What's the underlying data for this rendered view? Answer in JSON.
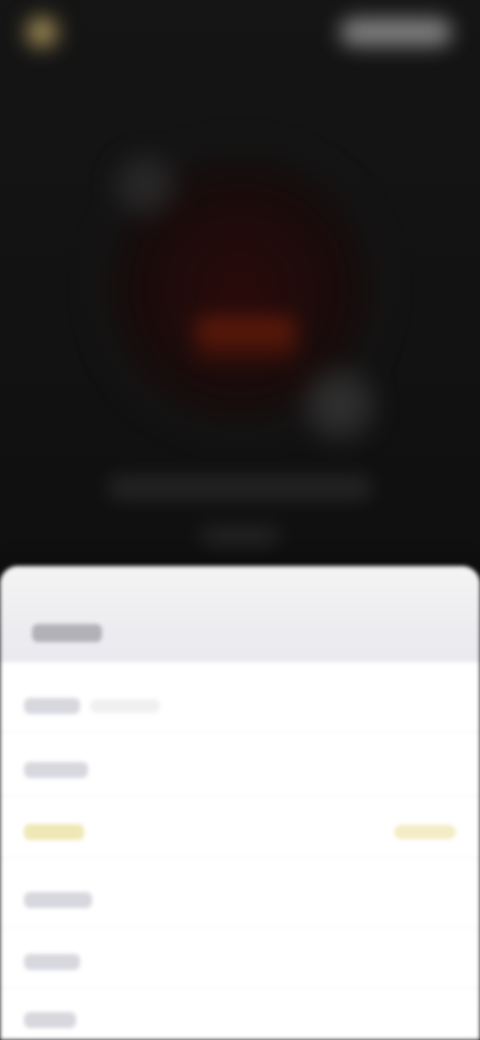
{
  "top": {
    "brand": "",
    "top_action": "",
    "hero_cta": "",
    "hero_caption": "",
    "hero_sub": ""
  },
  "sheet": {
    "title": "",
    "items": [
      {
        "label": "",
        "chip": ""
      },
      {
        "label": ""
      },
      {
        "label": "",
        "value": ""
      },
      {
        "label": ""
      },
      {
        "label": ""
      },
      {
        "label": ""
      }
    ]
  },
  "colors": {
    "background": "#0d0d0d",
    "accent": "#c7b274",
    "highlight": "#f0e7b5",
    "sheet": "#ffffff"
  },
  "icons": {
    "logo": "logo-icon"
  }
}
